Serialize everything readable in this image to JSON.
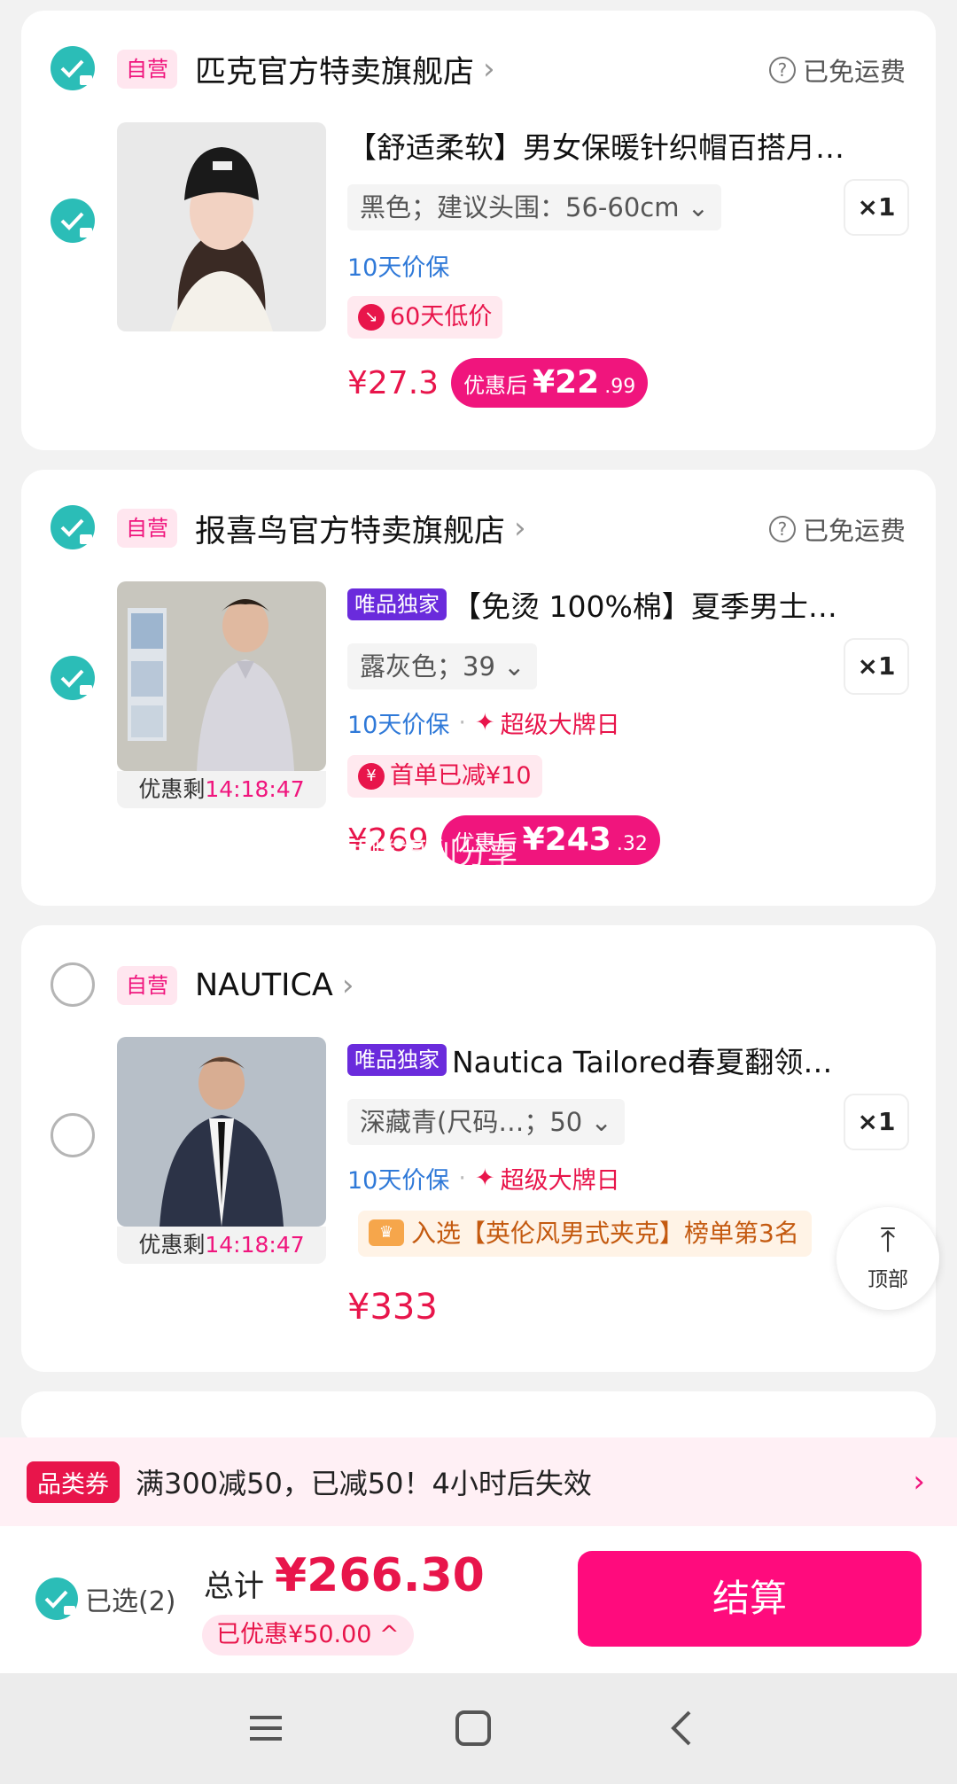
{
  "stores": [
    {
      "tag": "自营",
      "name": "匹克官方特卖旗舰店",
      "free_shipping": "已免运费",
      "product": {
        "title": "【舒适柔软】男女保暖针织帽百搭月…",
        "spec": "黑色；建议头围：56-60cm",
        "qty": "×1",
        "service": "10天价保",
        "badge": "60天低价",
        "price": "¥27.3",
        "after_label": "优惠后",
        "after_price": "¥22",
        "after_dec": ".99"
      }
    },
    {
      "tag": "自营",
      "name": "报喜鸟官方特卖旗舰店",
      "free_shipping": "已免运费",
      "product": {
        "vip_tag": "唯品独家",
        "title": "【免烫 100%棉】夏季男士…",
        "spec": "露灰色；39",
        "qty": "×1",
        "service": "10天价保",
        "service2": "超级大牌日",
        "badge": "首单已减¥10",
        "countdown_label": "优惠剩",
        "countdown": "14:18:47",
        "price": "¥269",
        "after_label": "优惠后",
        "after_price": "¥243",
        "after_dec": ".32"
      }
    },
    {
      "tag": "自营",
      "name": "NAUTICA",
      "product": {
        "vip_tag": "唯品独家",
        "title": "Nautica Tailored春夏翻领…",
        "spec": "深藏青(尺码…；50",
        "qty": "×1",
        "service": "10天价保",
        "service2": "超级大牌日",
        "rank": "入选【英伦风男式夹克】榜单第3名",
        "countdown_label": "优惠剩",
        "countdown": "14:18:47",
        "price": "¥333"
      }
    }
  ],
  "watermark": "易赚福利分享",
  "top_button": "顶部",
  "coupon": {
    "tag": "品类券",
    "text": "满300减50，已减50！4小时后失效"
  },
  "footer": {
    "selected": "已选(2)",
    "total_label": "总计",
    "total": "¥266.30",
    "saved": "已优惠¥50.00 ^",
    "checkout": "结算"
  },
  "colors": {
    "accent": "#f0157d",
    "check": "#2bbdb7",
    "vip": "#6a2bdc",
    "service": "#2f79d8"
  }
}
